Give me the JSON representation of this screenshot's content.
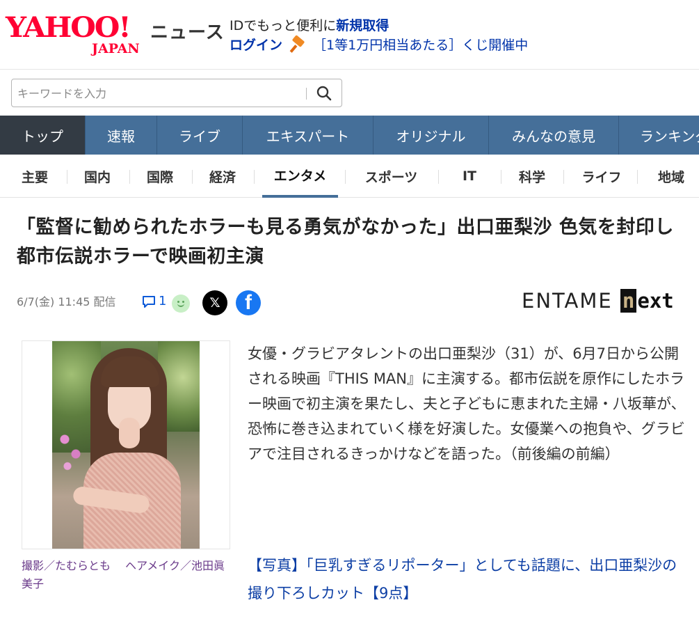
{
  "header": {
    "logo_main": "YAHOO!",
    "logo_sub": "JAPAN",
    "service": "ニュース",
    "id_prefix": "IDでもっと便利に",
    "id_link": "新規取得",
    "login": "ログイン",
    "lottery": "［1等1万円相当あたる］くじ開催中"
  },
  "search": {
    "placeholder": "キーワードを入力"
  },
  "main_nav": [
    "トップ",
    "速報",
    "ライブ",
    "エキスパート",
    "オリジナル",
    "みんなの意見",
    "ランキング"
  ],
  "sub_nav": [
    "主要",
    "国内",
    "国際",
    "経済",
    "エンタメ",
    "スポーツ",
    "IT",
    "科学",
    "ライフ",
    "地域"
  ],
  "sub_nav_active": "エンタメ",
  "article": {
    "title": "「監督に勧められたホラーも見る勇気がなかった」出口亜梨沙 色気を封印し都市伝説ホラーで映画初主演",
    "date": "6/7(金) 11:45",
    "published": "配信",
    "comment_count": "1",
    "source_logo": "ENTAME",
    "source_logo_next": "next",
    "caption": "撮影／たむらとも　 ヘアメイク／池田眞美子",
    "body": "女優・グラビアタレントの出口亜梨沙（31）が、6月7日から公開される映画『THIS MAN』に主演する。都市伝説を原作にしたホラー映画で初主演を果たし、夫と子どもに恵まれた主婦・八坂華が、恐怖に巻き込まれていく様を好演した。女優業への抱負や、グラビアで注目されるきっかけなどを語った。（前後編の前編）",
    "related_link": "【写真】「巨乳すぎるリポーター」としても話題に、出口亜梨沙の撮り下ろしカット【9点】"
  },
  "colors": {
    "brand": "#ff0033",
    "nav_bg": "#456f99",
    "nav_active": "#333b44",
    "link": "#0d3fa5"
  }
}
